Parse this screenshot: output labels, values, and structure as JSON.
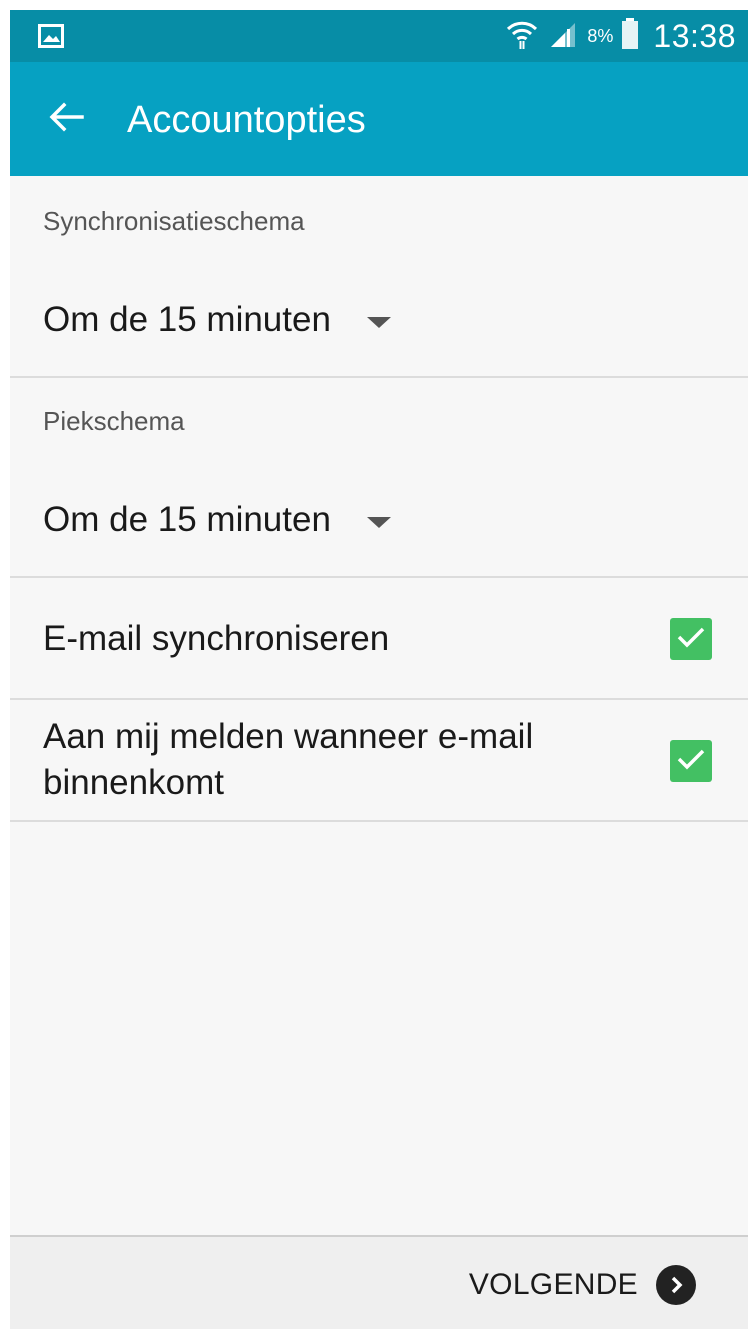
{
  "status_bar": {
    "battery_percent": "8%",
    "time": "13:38",
    "icons": [
      "gallery-icon",
      "wifi-icon",
      "signal-icon",
      "battery-icon"
    ]
  },
  "app_bar": {
    "title": "Accountopties",
    "back_icon": "arrow-left-icon"
  },
  "sync_schedule": {
    "label": "Synchronisatieschema",
    "value": "Om de 15 minuten"
  },
  "peak_schedule": {
    "label": "Piekschema",
    "value": "Om de 15 minuten"
  },
  "options": [
    {
      "label": "E-mail synchroniseren",
      "checked": true
    },
    {
      "label_line1": "Aan mij melden wanneer e-mail",
      "label_line2": "binnenkomt",
      "checked": true
    }
  ],
  "footer": {
    "next_label": "VOLGENDE",
    "next_icon": "chevron-right-circle-icon"
  },
  "colors": {
    "status_bar": "#078da6",
    "app_bar": "#06a1c2",
    "checkbox": "#43c063",
    "background": "#f7f7f7"
  }
}
